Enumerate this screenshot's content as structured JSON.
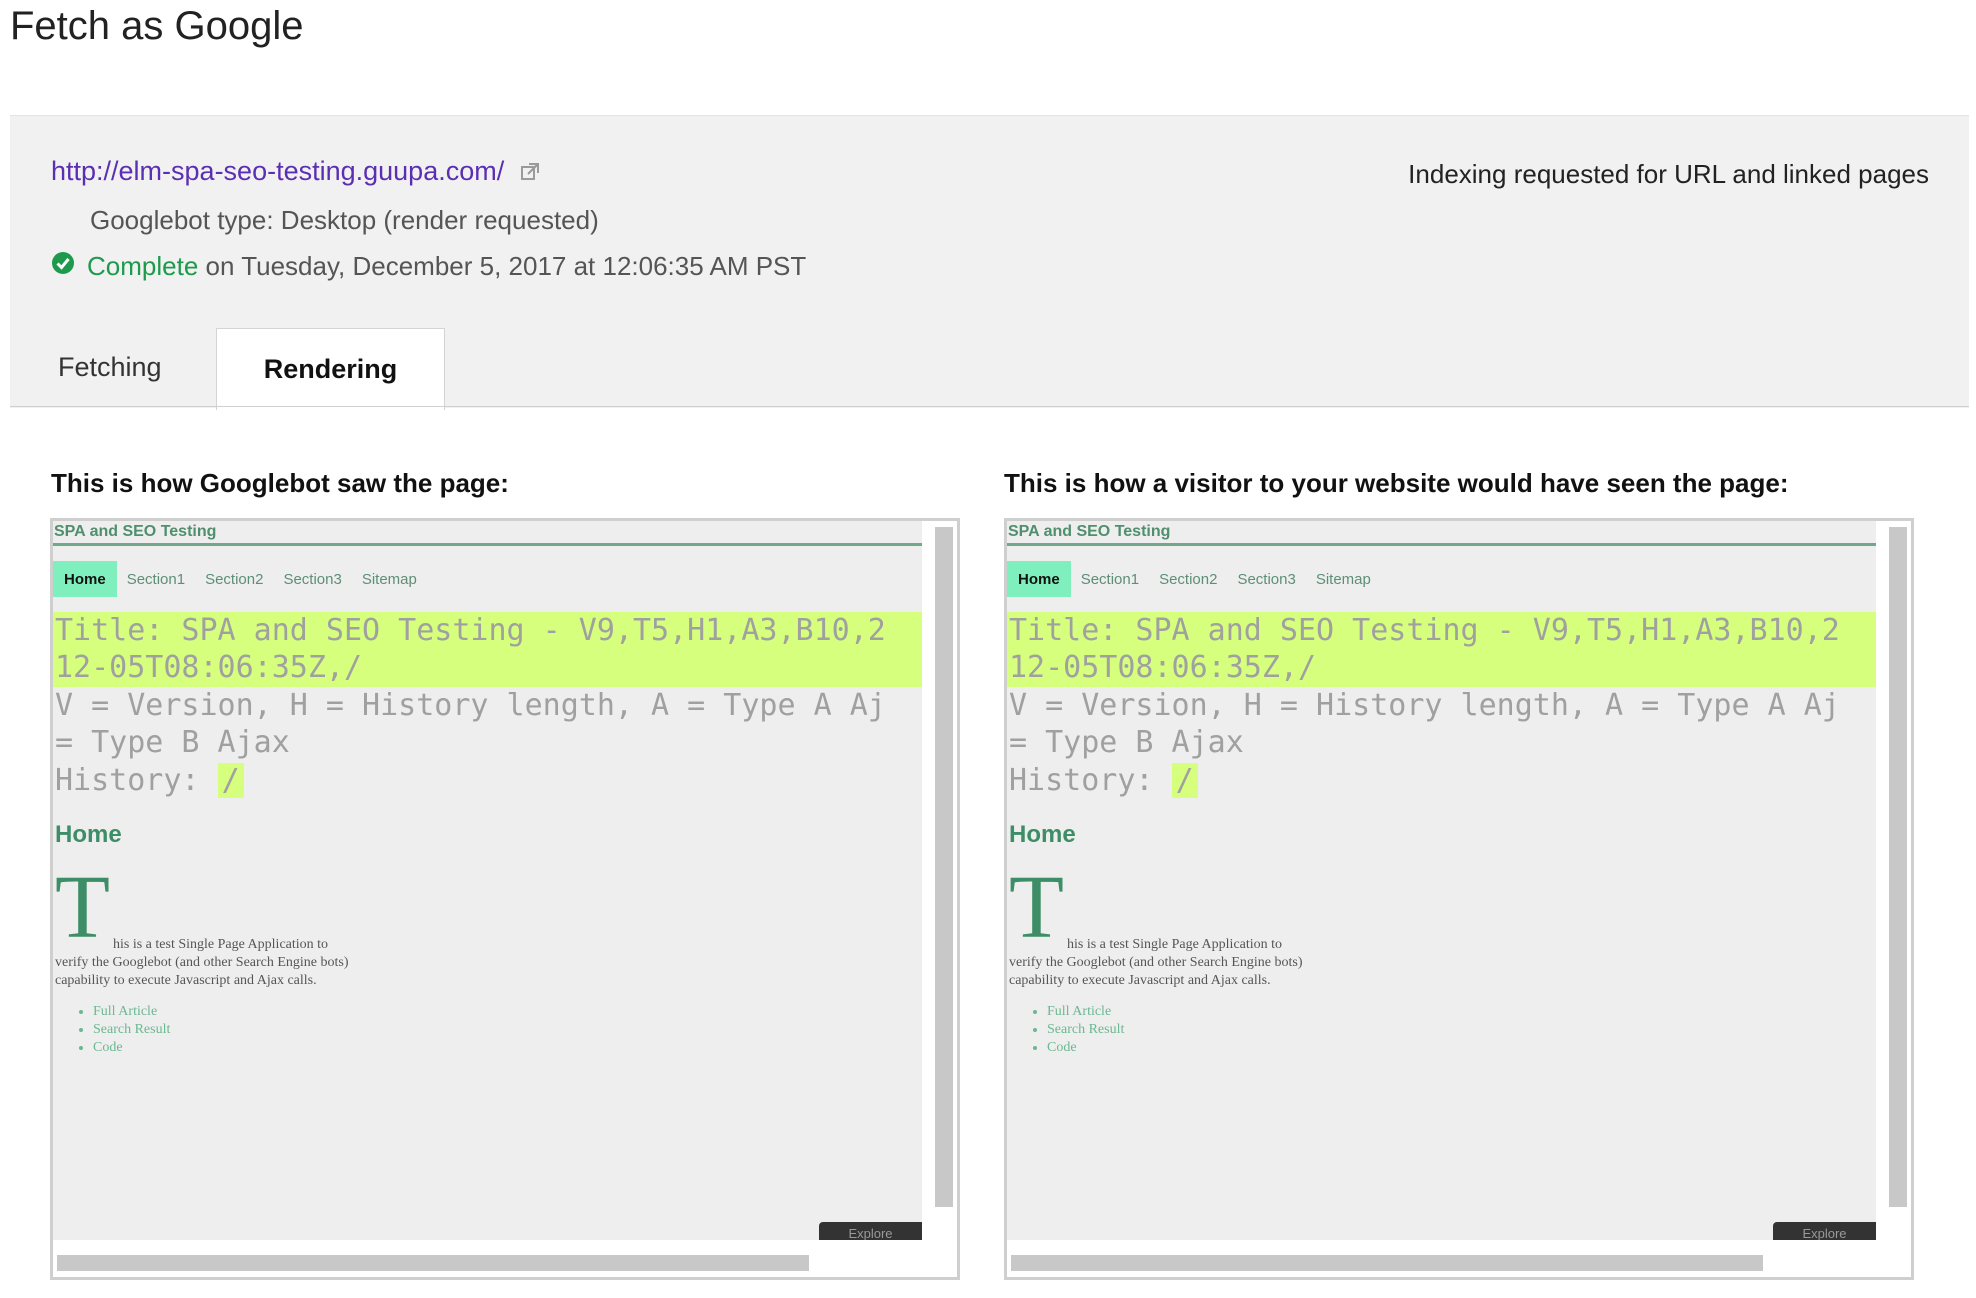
{
  "page_title": "Fetch as Google",
  "summary": {
    "url": "http://elm-spa-seo-testing.guupa.com/",
    "googlebot_type": "Googlebot type: Desktop (render requested)",
    "status_word": "Complete",
    "status_rest": "on Tuesday, December 5, 2017 at 12:06:35 AM PST",
    "indexing_status": "Indexing requested for URL and linked pages"
  },
  "tabs": [
    {
      "label": "Fetching"
    },
    {
      "label": "Rendering"
    }
  ],
  "columns": [
    {
      "title": "This is how Googlebot saw the page:"
    },
    {
      "title": "This is how a visitor to your website would have seen the page:"
    }
  ],
  "screenshot": {
    "site_name": "SPA and SEO Testing",
    "nav": [
      "Home",
      "Section1",
      "Section2",
      "Section3",
      "Sitemap"
    ],
    "title_line1": "Title: SPA and SEO Testing - V9,T5,H1,A3,B10,2",
    "title_line2": "12-05T08:06:35Z,/",
    "legend_line1": "V = Version, H = History length, A = Type A Aj",
    "legend_line2": "= Type B Ajax",
    "history_label": "History: ",
    "history_value": "/",
    "home_heading": "Home",
    "dropcap": "T",
    "body_line1": "his is a test Single Page Application to",
    "body_line2": "verify the Googlebot (and other Search Engine bots)",
    "body_line3": "capability to execute Javascript and Ajax calls.",
    "links": [
      "Full Article",
      "Search Result",
      "Code"
    ],
    "explore_label": "Explore"
  },
  "colors": {
    "accent_link": "#5b2fb3",
    "status_green": "#1e9a4c",
    "highlight": "#d6ff7e",
    "nav_active": "#7ff0bd"
  }
}
